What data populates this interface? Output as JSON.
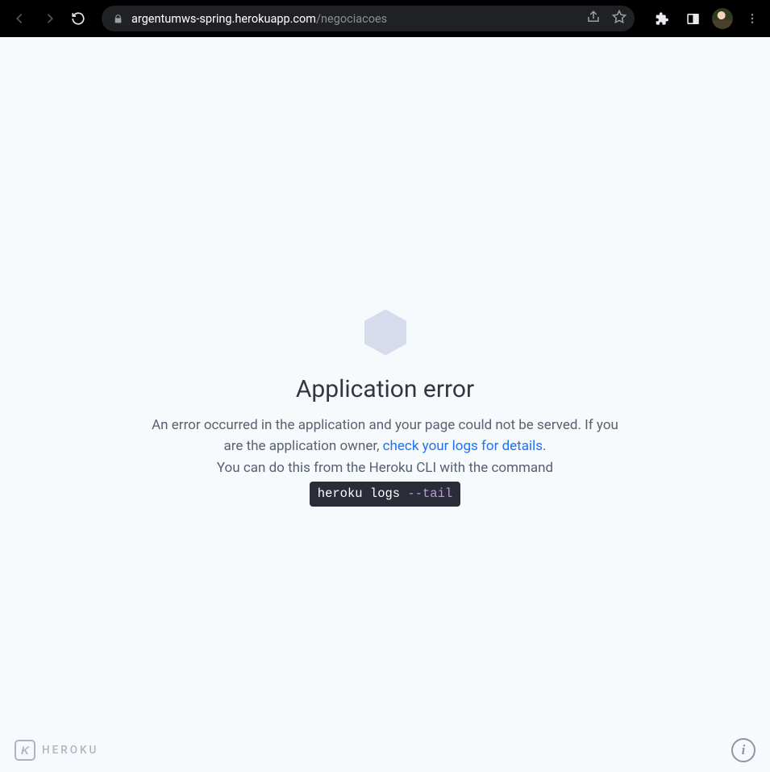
{
  "browser": {
    "url_domain": "argentumws-spring.herokuapp.com",
    "url_path": "/negociacoes"
  },
  "error": {
    "heading": "Application error",
    "message_part1": "An error occurred in the application and your page could not be served. If you are the application owner, ",
    "logs_link_text": "check your logs for details",
    "message_part2": ".",
    "cli_hint": "You can do this from the Heroku CLI with the command",
    "cli_command": "heroku logs ",
    "cli_flag": "--tail"
  },
  "footer": {
    "brand": "HEROKU",
    "mark_glyph": "K",
    "info_glyph": "i"
  }
}
